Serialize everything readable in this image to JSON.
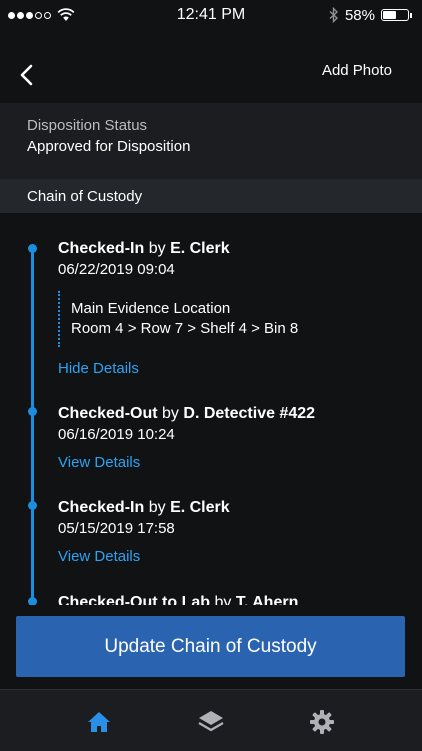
{
  "status_bar": {
    "time": "12:41 PM",
    "battery_percent": "58%",
    "battery_level": 0.58,
    "signal_bars_filled": 3,
    "signal_bars_total": 5,
    "icons": [
      "wifi-icon",
      "bluetooth-icon",
      "battery-icon"
    ]
  },
  "nav": {
    "back_icon": "chevron-left-icon",
    "add_photo_label": "Add Photo"
  },
  "disposition": {
    "label": "Disposition Status",
    "value": "Approved for Disposition"
  },
  "chain": {
    "section_title": "Chain of Custody",
    "entries": [
      {
        "action": "Checked-In",
        "by_word": "by",
        "person": "E. Clerk",
        "datetime": "06/22/2019  09:04",
        "details": {
          "location_title": "Main Evidence Location",
          "location_path": "Room 4 > Row 7 > Shelf 4 > Bin 8"
        },
        "link": "Hide Details"
      },
      {
        "action": "Checked-Out",
        "by_word": "by",
        "person": "D. Detective #422",
        "datetime": "06/16/2019  10:24",
        "link": "View Details"
      },
      {
        "action": "Checked-In",
        "by_word": "by",
        "person": "E. Clerk",
        "datetime": "05/15/2019  17:58",
        "link": "View Details"
      },
      {
        "action": "Checked-Out to Lab",
        "by_word": "by",
        "person": "T. Ahern"
      }
    ]
  },
  "update_button_label": "Update Chain of Custody",
  "tabs": [
    {
      "icon": "home-icon",
      "active": true
    },
    {
      "icon": "layers-icon",
      "active": false
    },
    {
      "icon": "gear-icon",
      "active": false
    }
  ],
  "colors": {
    "background": "#111214",
    "accent": "#1a8fe0",
    "link": "#2ea3f2",
    "button": "#2a63b0"
  }
}
